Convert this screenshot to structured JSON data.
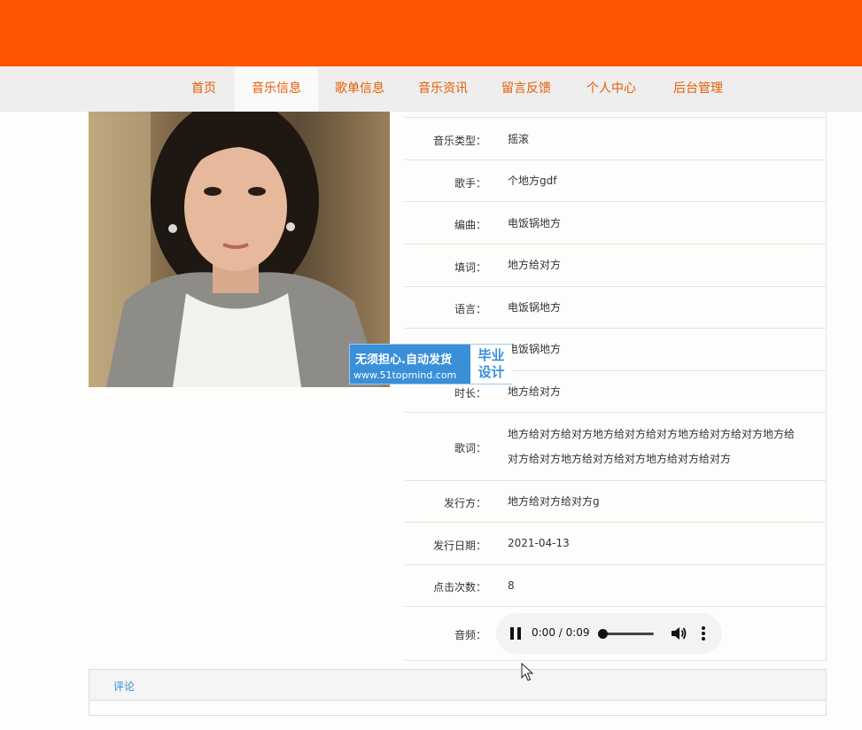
{
  "nav": {
    "items": [
      "首页",
      "音乐信息",
      "歌单信息",
      "音乐资讯",
      "留言反馈",
      "个人中心",
      "后台管理"
    ],
    "active": "音乐信息"
  },
  "details": {
    "rows": [
      {
        "label": "音乐类型：",
        "value": "摇滚"
      },
      {
        "label": "歌手：",
        "value": "个地方gdf"
      },
      {
        "label": "编曲：",
        "value": "电饭锅地方"
      },
      {
        "label": "填词：",
        "value": "地方给对方"
      },
      {
        "label": "语言：",
        "value": "电饭锅地方"
      },
      {
        "label": "",
        "value": "电饭锅地方"
      },
      {
        "label": "时长：",
        "value": "地方给对方"
      },
      {
        "label": "歌词：",
        "value": "地方给对方给对方地方给对方给对方地方给对方给对方地方给对方给对方地方给对方给对方地方给对方给对方"
      },
      {
        "label": "发行方：",
        "value": "地方给对方给对方g"
      },
      {
        "label": "发行日期：",
        "value": "2021-04-13"
      },
      {
        "label": "点击次数：",
        "value": "8"
      }
    ],
    "audio_label": "音频：",
    "audio": {
      "time": "0:00 / 0:09",
      "progress": 0
    }
  },
  "watermark": {
    "line1": "无须担心.自动发货",
    "line2": "www.51topmind.com",
    "box1": "毕业",
    "box2": "设计"
  },
  "comments": {
    "title": "评论"
  },
  "colors": {
    "topbar": "#ff5500",
    "nav_text": "#e65c00",
    "link": "#2a8fd0"
  }
}
